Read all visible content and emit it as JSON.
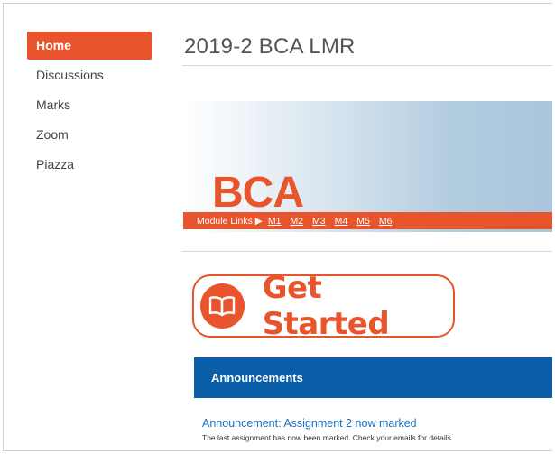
{
  "sidebar": {
    "items": [
      {
        "label": "Home",
        "active": true
      },
      {
        "label": "Discussions"
      },
      {
        "label": "Marks"
      },
      {
        "label": "Zoom"
      },
      {
        "label": "Piazza"
      }
    ]
  },
  "header": {
    "title": "2019-2 BCA LMR"
  },
  "banner": {
    "big_text": "BCA",
    "module_links_label": "Module Links ▶",
    "modules": [
      "M1",
      "M2",
      "M3",
      "M4",
      "M5",
      "M6"
    ]
  },
  "get_started": {
    "label": "Get Started",
    "icon": "book-icon"
  },
  "announcements": {
    "header": "Announcements",
    "items": [
      {
        "title": "Announcement: Assignment 2 now marked",
        "description": "The last assignment has now been marked. Check your emails for details"
      }
    ]
  },
  "colors": {
    "accent": "#e8542c",
    "announcement_header": "#0b5ea8",
    "link": "#1a6fc0"
  }
}
